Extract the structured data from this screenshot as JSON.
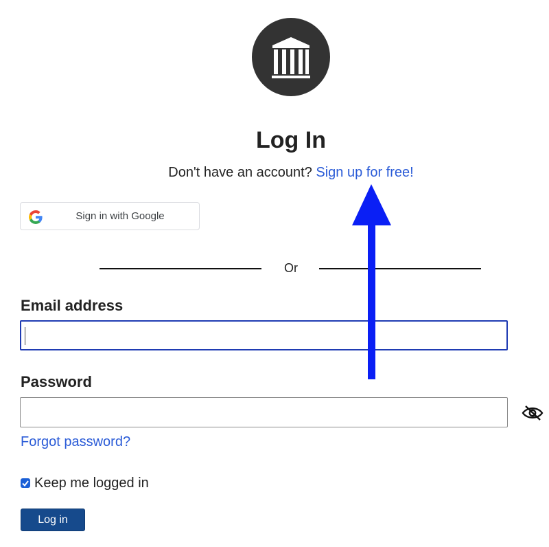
{
  "header": {
    "logo_icon": "institution-pillars-icon",
    "title": "Log In",
    "signup_prompt": "Don't have an account?",
    "signup_link": "Sign up for free!"
  },
  "google": {
    "icon": "google-g-icon",
    "label": "Sign in with Google"
  },
  "divider": {
    "text": "Or"
  },
  "form": {
    "email_label": "Email address",
    "email_value": "",
    "password_label": "Password",
    "password_value": "",
    "password_toggle_icon": "eye-slash-icon",
    "forgot_password": "Forgot password?",
    "keep_logged_in_label": "Keep me logged in",
    "keep_logged_in_checked": true,
    "login_button": "Log in"
  },
  "annotation": {
    "arrow_icon": "upward-arrow-icon",
    "arrow_color": "#0a1ff5"
  },
  "colors": {
    "link": "#2a5bd7",
    "primary_button": "#164a8c",
    "focus_border": "#1f3bb3",
    "logo_background": "#333333"
  }
}
